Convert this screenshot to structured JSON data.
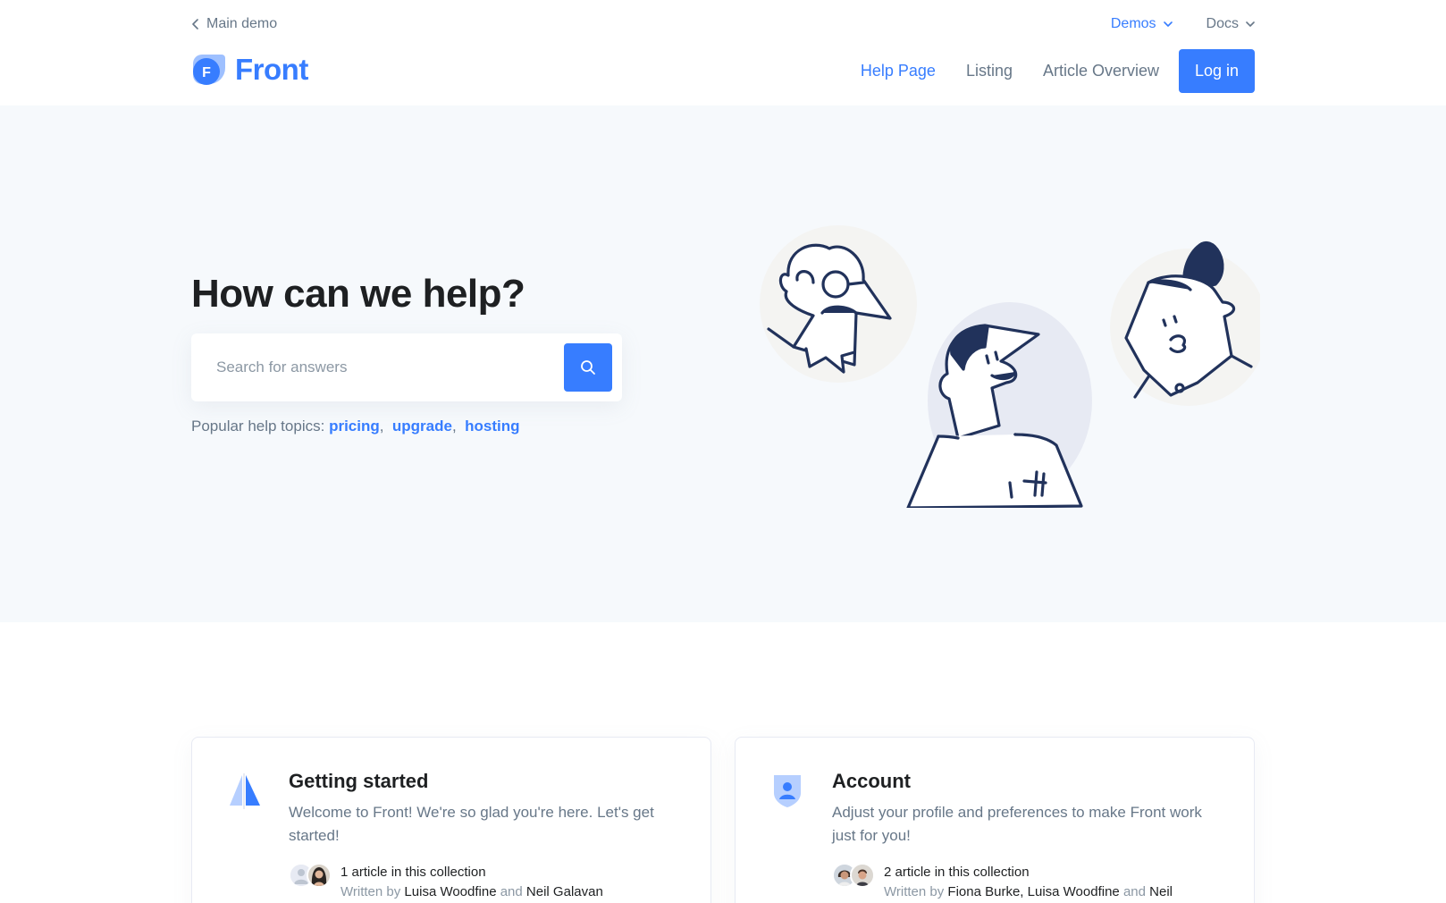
{
  "header": {
    "back_label": "Main demo",
    "top_nav": [
      {
        "label": "Demos",
        "active": true
      },
      {
        "label": "Docs",
        "active": false
      }
    ],
    "logo_letter": "F",
    "logo_text": "Front",
    "main_nav": [
      {
        "label": "Help Page",
        "active": true
      },
      {
        "label": "Listing",
        "active": false
      },
      {
        "label": "Article Overview",
        "active": false
      }
    ],
    "login_label": "Log in"
  },
  "hero": {
    "title": "How can we help?",
    "search_placeholder": "Search for answers",
    "topics_label": "Popular help topics:",
    "topics": [
      "pricing",
      "upgrade",
      "hosting"
    ]
  },
  "cards": [
    {
      "title": "Getting started",
      "description": "Welcome to Front! We're so glad you're here. Let's get started!",
      "count": "1 article in this collection",
      "written_by": "Written by",
      "author_a": "Luisa Woodfine",
      "joiner": "and",
      "author_b": "Neil Galavan"
    },
    {
      "title": "Account",
      "description": "Adjust your profile and preferences to make Front work just for you!",
      "count": "2 article in this collection",
      "written_by": "Written by",
      "author_a": "Fiona Burke, Luisa Woodfine",
      "joiner": "and",
      "author_b": "Neil"
    }
  ],
  "colors": {
    "accent": "#377dff",
    "hero_bg": "#f6f9fc",
    "text_dark": "#1e2022",
    "text_muted": "#677788",
    "illustration_ink": "#21325b"
  },
  "icons": [
    "chevron-left-icon",
    "chevron-down-icon",
    "search-icon",
    "getting-started-icon",
    "account-shield-icon"
  ]
}
